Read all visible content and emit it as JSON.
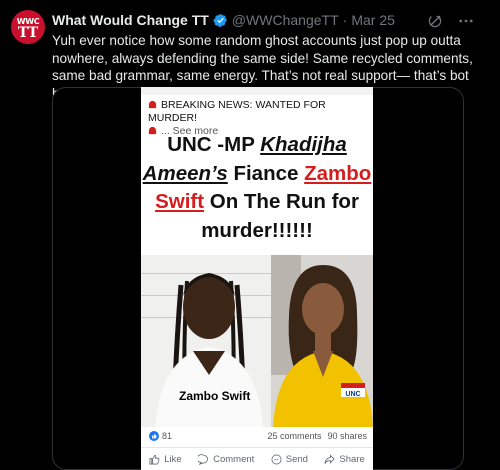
{
  "tweet": {
    "avatar_text_top": "WWC",
    "avatar_text_bottom": "TT",
    "display_name": "What Would Change TT",
    "handle": "@WWChangeTT",
    "separator": "·",
    "date": "Mar 25",
    "text": "Yuh ever notice how some random ghost accounts just pop up outta nowhere, always defending the same side! Same recycled comments, same bad grammar, same energy. That’s not real support— that’s bot behavior!"
  },
  "icons": {
    "verified": "verified-badge-icon",
    "grok": "grok-icon",
    "more": "more-options-icon"
  },
  "colors": {
    "background": "#000000",
    "text_primary": "#e7e9ea",
    "text_secondary": "#71767b",
    "verified_blue": "#1d9bf0",
    "headline_red": "#d51d1d"
  },
  "embedded_post": {
    "caption": "BREAKING NEWS: WANTED FOR MURDER!",
    "see_more": "... See more",
    "headline_part1": "UNC -MP ",
    "headline_part2": "Khadijha Ameen’s",
    "headline_part3": " Fiance ",
    "headline_part4": "Zambo Swift",
    "headline_part5": " On The Run for murder!!!!!!",
    "name_tag": "Zambo Swift",
    "like_count": "81",
    "comments": "25 comments",
    "shares": "90 shares",
    "actions": {
      "like": "Like",
      "comment": "Comment",
      "send": "Send",
      "share": "Share"
    }
  }
}
